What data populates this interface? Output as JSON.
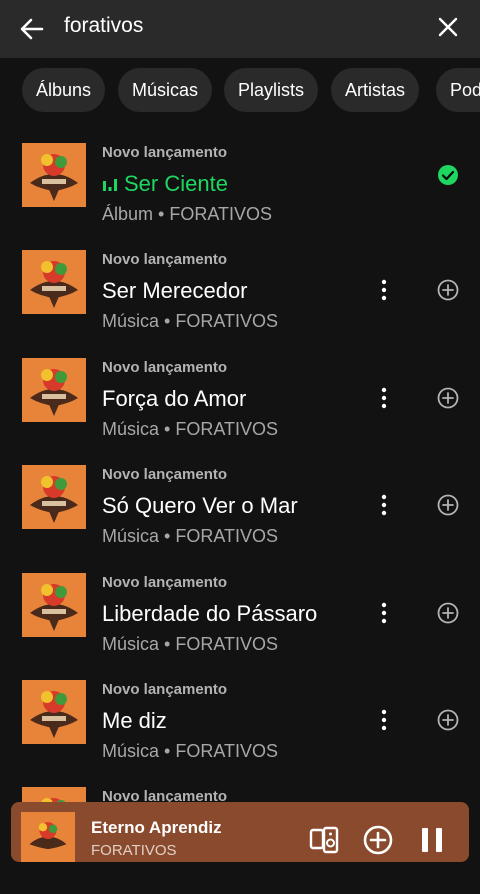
{
  "search": {
    "query": "forativos"
  },
  "filters": [
    "Álbuns",
    "Músicas",
    "Playlists",
    "Artistas",
    "Podcasts"
  ],
  "results": [
    {
      "kicker": "Novo lançamento",
      "title": "Ser Ciente",
      "subtitle": "Álbum • FORATIVOS",
      "playing": true,
      "saved": true
    },
    {
      "kicker": "Novo lançamento",
      "title": "Ser Merecedor",
      "subtitle": "Música • FORATIVOS"
    },
    {
      "kicker": "Novo lançamento",
      "title": "Força do Amor",
      "subtitle": "Música • FORATIVOS"
    },
    {
      "kicker": "Novo lançamento",
      "title": "Só Quero Ver o Mar",
      "subtitle": "Música • FORATIVOS"
    },
    {
      "kicker": "Novo lançamento",
      "title": "Liberdade do Pássaro",
      "subtitle": "Música • FORATIVOS"
    },
    {
      "kicker": "Novo lançamento",
      "title": "Me diz",
      "subtitle": "Música • FORATIVOS"
    },
    {
      "kicker": "Novo lançamento",
      "title": "",
      "subtitle": ""
    }
  ],
  "player": {
    "title": "Eterno Aprendiz",
    "artist": "FORATIVOS"
  },
  "colors": {
    "accent": "#1ed760",
    "cover": "#e8833a",
    "player_bg": "#8a4a2d"
  }
}
